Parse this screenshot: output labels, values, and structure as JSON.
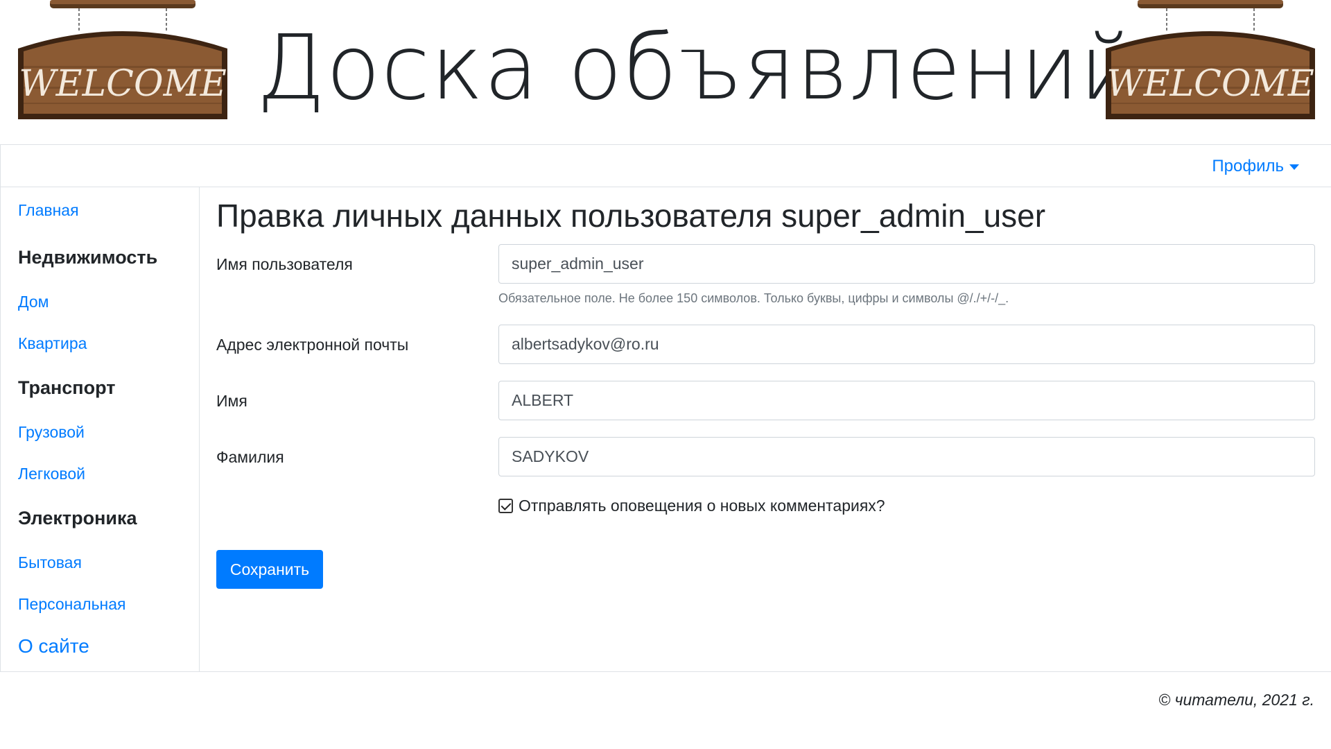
{
  "header": {
    "site_title": "Доска объявлений",
    "sign_text": "WELCOME"
  },
  "navbar": {
    "profile_label": "Профиль"
  },
  "sidebar": {
    "items": [
      {
        "label": "Главная",
        "type": "link"
      },
      {
        "label": "Недвижимость",
        "type": "heading"
      },
      {
        "label": "Дом",
        "type": "link"
      },
      {
        "label": "Квартира",
        "type": "link"
      },
      {
        "label": "Транспорт",
        "type": "heading"
      },
      {
        "label": "Грузовой",
        "type": "link"
      },
      {
        "label": "Легковой",
        "type": "link"
      },
      {
        "label": "Электроника",
        "type": "heading"
      },
      {
        "label": "Бытовая",
        "type": "link"
      },
      {
        "label": "Персональная",
        "type": "link"
      },
      {
        "label": "О сайте",
        "type": "link"
      }
    ]
  },
  "main": {
    "title": "Правка личных данных пользователя super_admin_user",
    "form": {
      "username": {
        "label": "Имя пользователя",
        "value": "super_admin_user"
      },
      "username_help": "Обязательное поле. Не более 150 символов. Только буквы, цифры и символы @/./+/-/_.",
      "email": {
        "label": "Адрес электронной почты",
        "value": "albertsadykov@ro.ru"
      },
      "first_name": {
        "label": "Имя",
        "value": "ALBERT"
      },
      "last_name": {
        "label": "Фамилия",
        "value": "SADYKOV"
      },
      "notify": {
        "label": "Отправлять оповещения о новых комментариях?",
        "checked": true
      },
      "save_label": "Сохранить"
    }
  },
  "footer": {
    "copyright": "© читатели, 2021 г."
  },
  "colors": {
    "link": "#007bff",
    "button": "#007bff",
    "sign_wood": "#7a4f2c",
    "border": "#dee2e6"
  }
}
